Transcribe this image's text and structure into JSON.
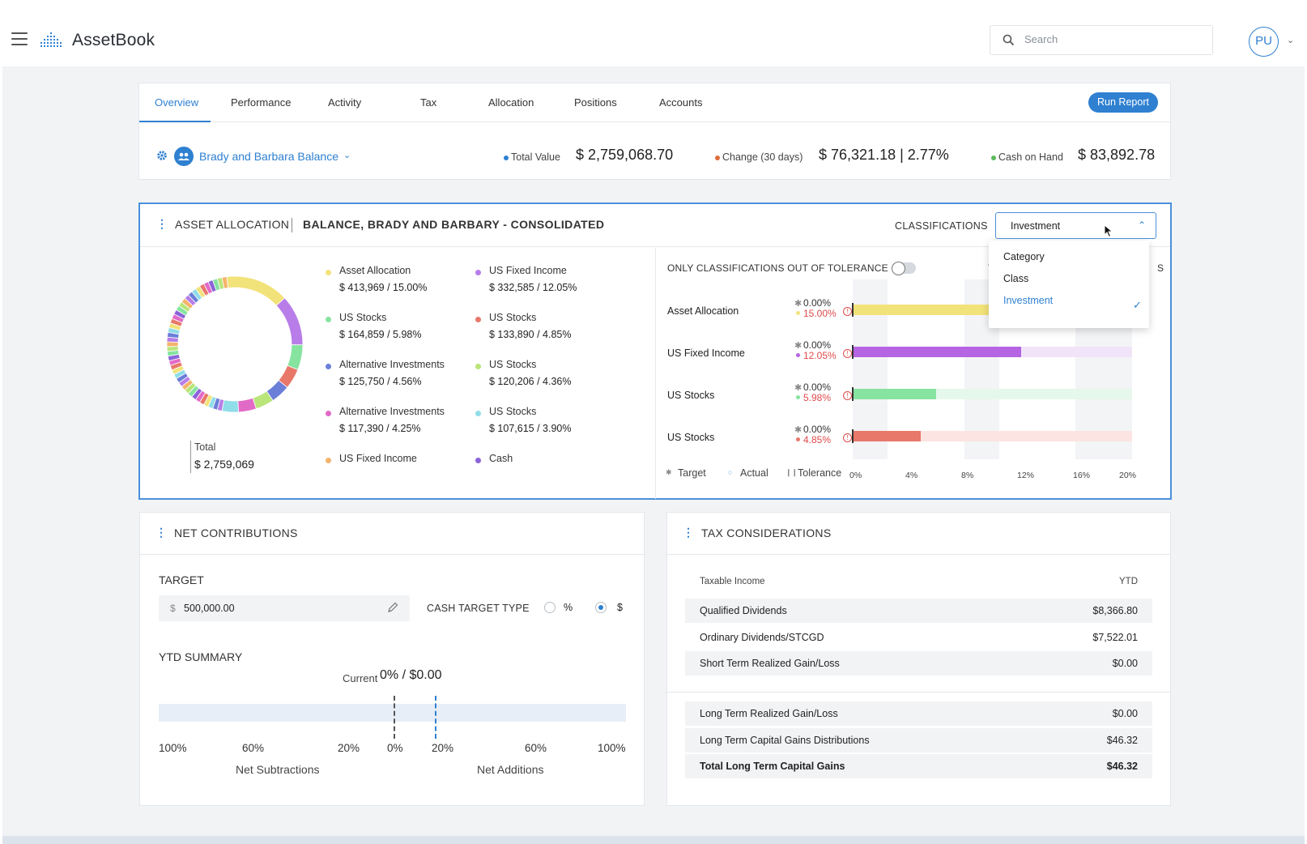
{
  "app": {
    "title": "AssetBook"
  },
  "search": {
    "placeholder": "Search",
    "value": ""
  },
  "user": {
    "initials": "PU"
  },
  "tabs": [
    {
      "label": "Overview",
      "active": true
    },
    {
      "label": "Performance"
    },
    {
      "label": "Activity"
    },
    {
      "label": "Tax"
    },
    {
      "label": "Allocation"
    },
    {
      "label": "Positions"
    },
    {
      "label": "Accounts"
    }
  ],
  "run_report": "Run Report",
  "account": {
    "name": "Brady and Barbara Balance",
    "metrics": [
      {
        "label": "Total Value",
        "value": "$ 2,759,068.70",
        "color": "#2f80d1"
      },
      {
        "label": "Change (30 days)",
        "value": "$ 76,321.18 | 2.77%",
        "color": "#e06c3c"
      },
      {
        "label": "Cash on Hand",
        "value": "$ 83,892.78",
        "color": "#5cb85c"
      }
    ]
  },
  "asset_allocation": {
    "title": "ASSET ALLOCATION",
    "subtitle": "BALANCE, BRADY AND BARBARY - CONSOLIDATED",
    "classifications_label": "CLASSIFICATIONS",
    "selected_classification": "Investment",
    "dropdown_options": [
      {
        "label": "Category",
        "selected": false
      },
      {
        "label": "Class",
        "selected": false
      },
      {
        "label": "Investment",
        "selected": true
      }
    ],
    "total_label": "Total",
    "total_value": "$ 2,759,069",
    "legend": [
      {
        "name": "Asset Allocation",
        "value": "$ 413,969 / 15.00%",
        "color": "#f2e27a"
      },
      {
        "name": "US Fixed Income",
        "value": "$ 332,585 / 12.05%",
        "color": "#b87de8"
      },
      {
        "name": "US Stocks",
        "value": "$ 164,859 / 5.98%",
        "color": "#86e3a0"
      },
      {
        "name": "US Stocks",
        "value": "$ 133,890 / 4.85%",
        "color": "#e8786a"
      },
      {
        "name": "Alternative Investments",
        "value": "$ 125,750 / 4.56%",
        "color": "#6b7fd8"
      },
      {
        "name": "US Stocks",
        "value": "$ 120,206 / 4.36%",
        "color": "#b9e57a"
      },
      {
        "name": "Alternative Investments",
        "value": "$ 117,390 / 4.25%",
        "color": "#e26ac7"
      },
      {
        "name": "US Stocks",
        "value": "$ 107,615 / 3.90%",
        "color": "#8fdde8"
      },
      {
        "name": "US Fixed Income",
        "value": "",
        "color": "#f5b36b"
      },
      {
        "name": "Cash",
        "value": "",
        "color": "#8b63d9"
      }
    ],
    "tolerance_toggle_label": "ONLY CLASSIFICATIONS OUT OF TOLERANCE",
    "tolerance_toggle_on": false,
    "partial_header_left": "T",
    "partial_header_right": "S",
    "bars": [
      {
        "name": "Asset Allocation",
        "target": "0.00%",
        "actual": "15.00%",
        "actual_value": 15.0,
        "color": "#f2e27a",
        "track": "#fbf6d8"
      },
      {
        "name": "US Fixed Income",
        "target": "0.00%",
        "actual": "12.05%",
        "actual_value": 12.05,
        "color": "#b565e3",
        "track": "#f1e4f9"
      },
      {
        "name": "US Stocks",
        "target": "0.00%",
        "actual": "5.98%",
        "actual_value": 5.98,
        "color": "#86e3a0",
        "track": "#e5f8eb"
      },
      {
        "name": "US Stocks",
        "target": "0.00%",
        "actual": "4.85%",
        "actual_value": 4.85,
        "color": "#e8786a",
        "track": "#fbe4e1"
      }
    ],
    "bar_axis": [
      "0%",
      "4%",
      "8%",
      "12%",
      "16%",
      "20%"
    ],
    "bar_axis_max": 20,
    "bar_legend": [
      "Target",
      "Actual",
      "Tolerance"
    ]
  },
  "net_contributions": {
    "title": "NET CONTRIBUTIONS",
    "target_label": "TARGET",
    "currency_symbol": "$",
    "target_value": "500,000.00",
    "cash_target_type_label": "CASH TARGET TYPE",
    "options": [
      {
        "label": "%",
        "selected": false
      },
      {
        "label": "$",
        "selected": true
      }
    ],
    "ytd_label": "YTD SUMMARY",
    "current_label": "Current",
    "current_value": "0% / $0.00",
    "ticks": [
      "100%",
      "60%",
      "20%",
      "0%",
      "20%",
      "60%",
      "100%"
    ],
    "left_caption": "Net Subtractions",
    "right_caption": "Net Additions"
  },
  "tax": {
    "title": "TAX CONSIDERATIONS",
    "col_left": "Taxable Income",
    "col_right": "YTD",
    "rows_top": [
      {
        "name": "Qualified Dividends",
        "value": "$8,366.80"
      },
      {
        "name": "Ordinary Dividends/STCGD",
        "value": "$7,522.01"
      },
      {
        "name": "Short Term Realized Gain/Loss",
        "value": "$0.00"
      }
    ],
    "rows_bottom": [
      {
        "name": "Long Term Realized Gain/Loss",
        "value": "$0.00"
      },
      {
        "name": "Long Term Capital Gains Distributions",
        "value": "$46.32"
      },
      {
        "name": "Total Long Term Capital Gains",
        "value": "$46.32"
      }
    ]
  }
}
